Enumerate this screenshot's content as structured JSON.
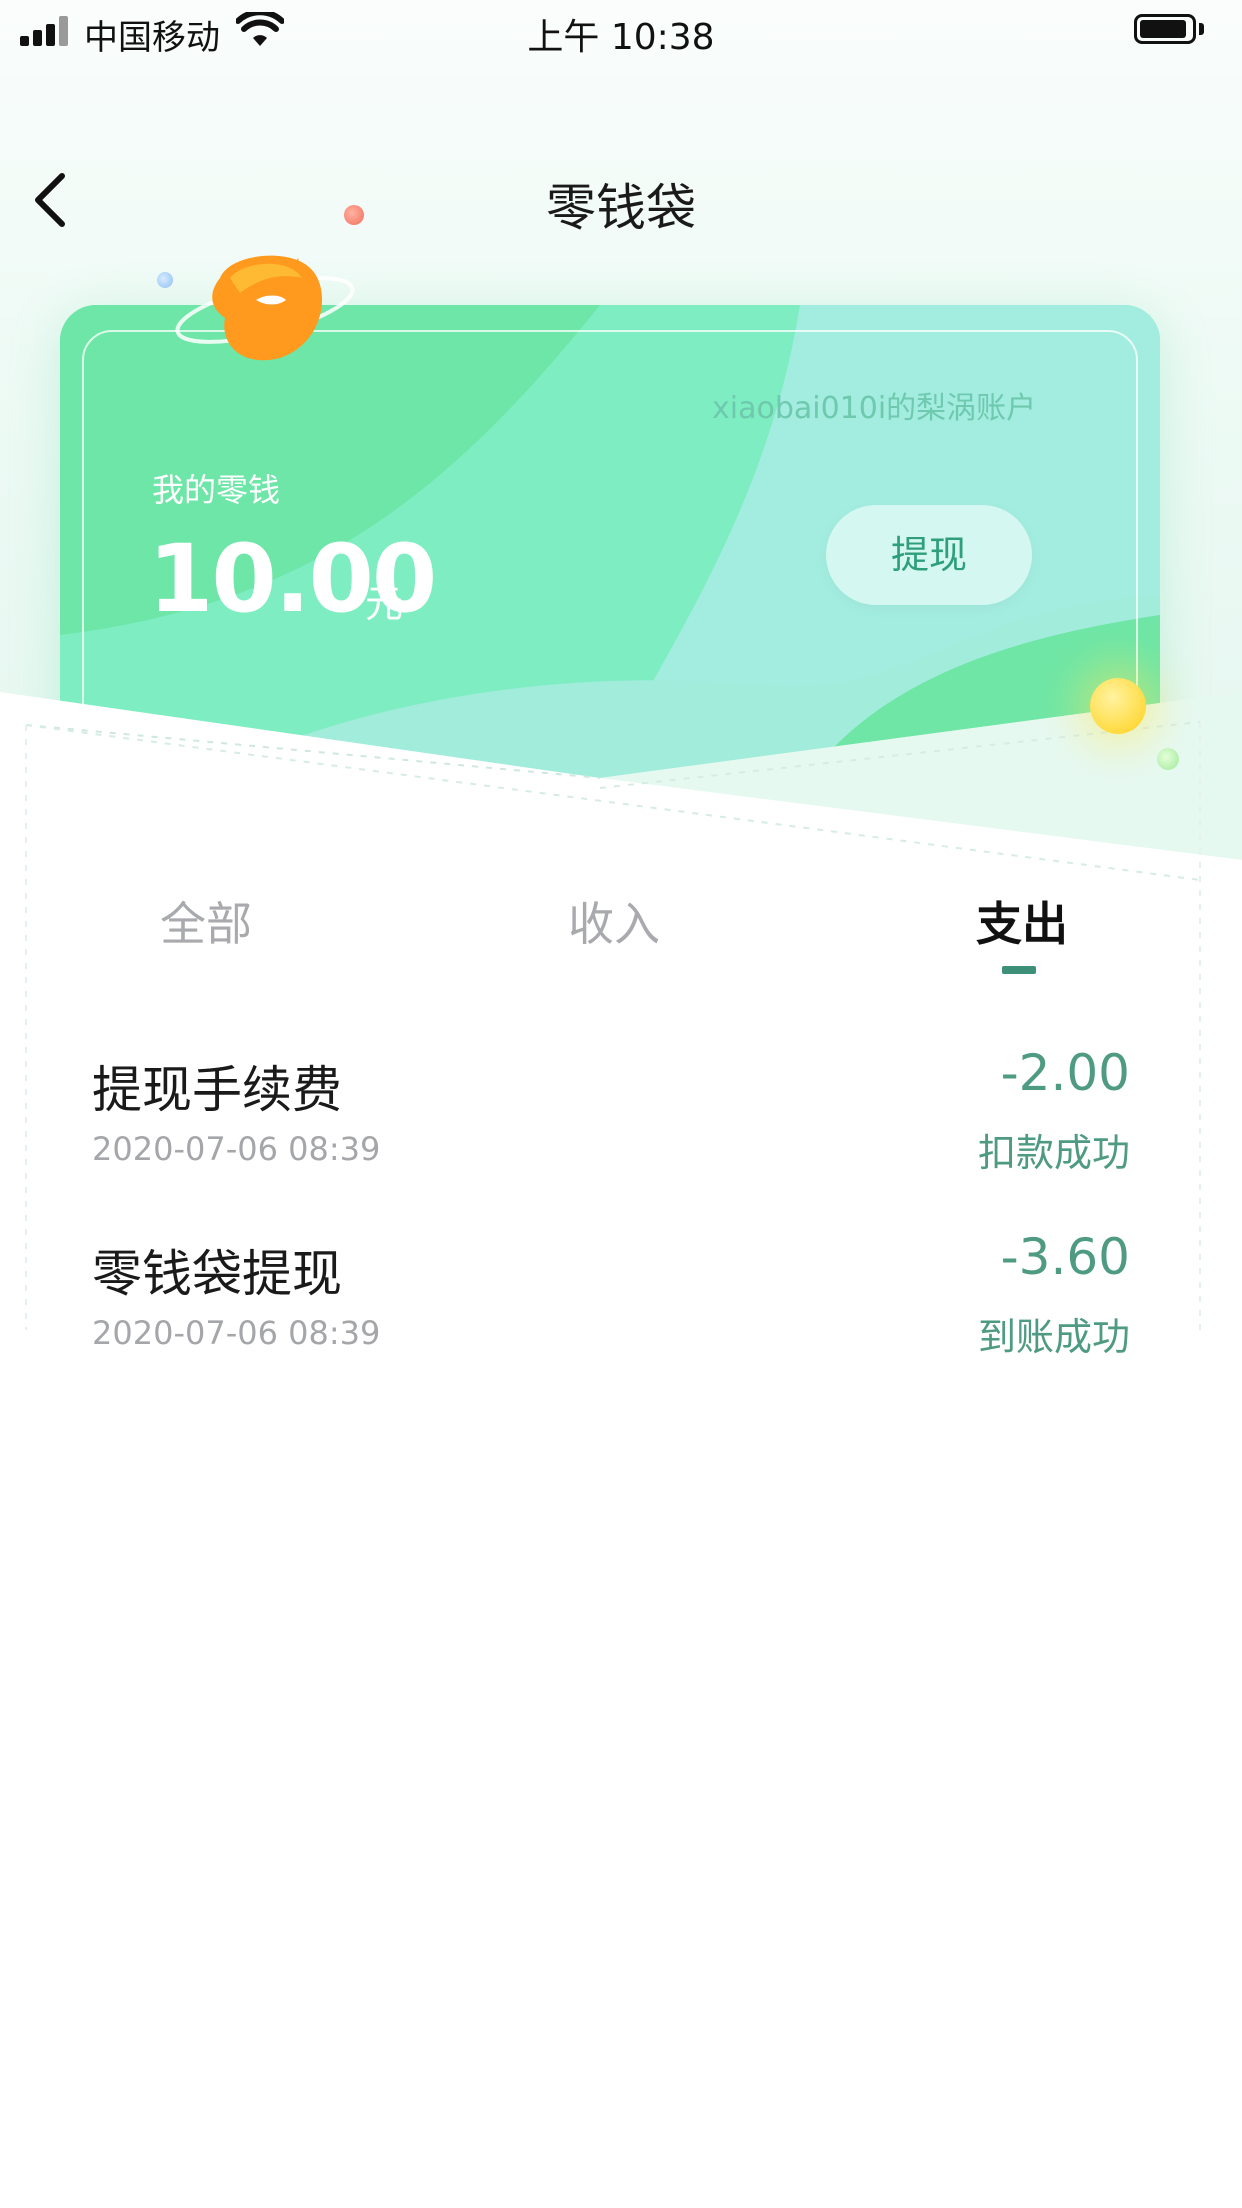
{
  "status_bar": {
    "carrier": "中国移动",
    "time": "上午 10:38"
  },
  "nav": {
    "title": "零钱袋",
    "back_icon": "chevron-left-icon"
  },
  "card": {
    "account_label": "xiaobai010i的梨涡账户",
    "balance_label": "我的零钱",
    "balance_amount": "10.00",
    "balance_unit": "元",
    "withdraw_button": "提现",
    "mascot_icon": "orange-planet-mascot"
  },
  "tabs": [
    {
      "label": "全部",
      "active": false
    },
    {
      "label": "收入",
      "active": false
    },
    {
      "label": "支出",
      "active": true
    }
  ],
  "transactions": [
    {
      "title": "提现手续费",
      "date": "2020-07-06 08:39",
      "amount": "-2.00",
      "status": "扣款成功"
    },
    {
      "title": "零钱袋提现",
      "date": "2020-07-06 08:39",
      "amount": "-3.60",
      "status": "到账成功"
    }
  ],
  "colors": {
    "accent": "#4e9a82",
    "card_green": "#6de6a8",
    "tab_active": "#111111",
    "tab_inactive": "#a9aaad"
  }
}
